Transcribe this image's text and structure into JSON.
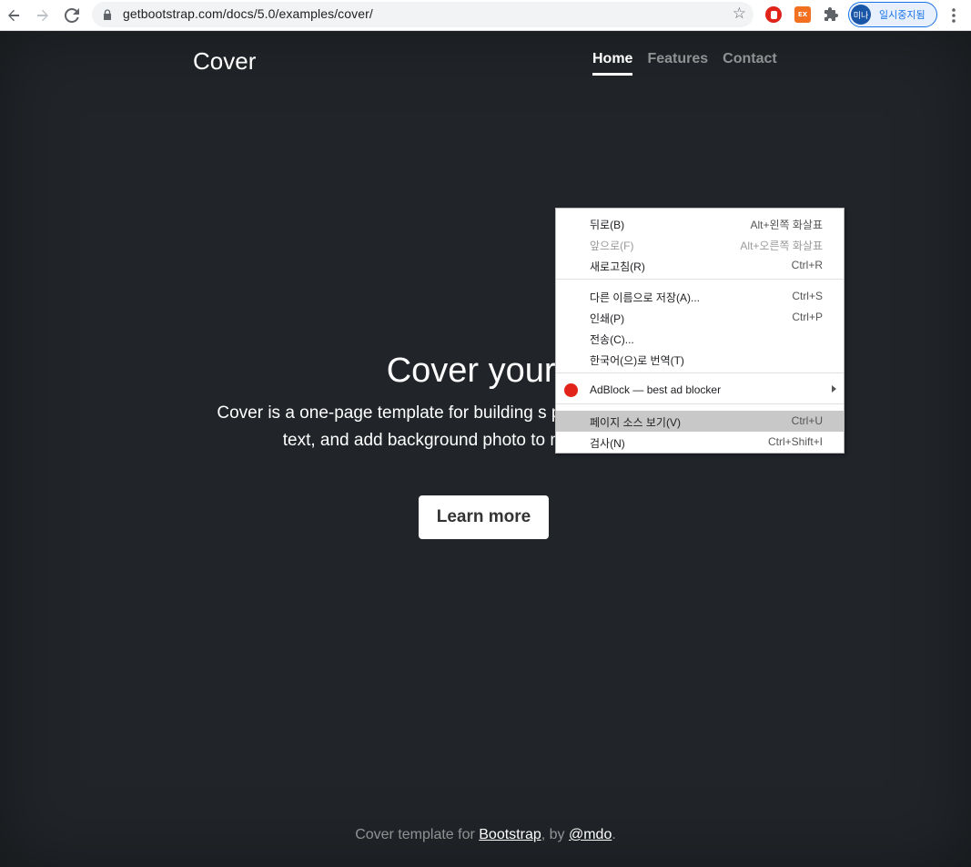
{
  "browser": {
    "url": "getbootstrap.com/docs/5.0/examples/cover/",
    "profile_initials": "미나",
    "profile_label": "일시중지됨",
    "ext_badge": "EX"
  },
  "page": {
    "brand": "Cover",
    "nav": [
      "Home",
      "Features",
      "Contact"
    ],
    "hero_title": "Cover your p",
    "lead": "Cover is a one-page template for building s pages. Download, edit the text, and add background photo to make it your own.",
    "button": "Learn more",
    "footer": {
      "prefix": "Cover template for ",
      "link1": "Bootstrap",
      "middle": ", by ",
      "link2": "@mdo",
      "suffix": "."
    }
  },
  "context_menu": {
    "items": [
      {
        "label": "뒤로(B)",
        "shortcut": "Alt+왼쪽 화살표"
      },
      {
        "label": "앞으로(F)",
        "shortcut": "Alt+오른쪽 화살표"
      },
      {
        "label": "새로고침(R)",
        "shortcut": "Ctrl+R"
      },
      {
        "label": "다른 이름으로 저장(A)...",
        "shortcut": "Ctrl+S"
      },
      {
        "label": "인쇄(P)",
        "shortcut": "Ctrl+P"
      },
      {
        "label": "전송(C)...",
        "shortcut": ""
      },
      {
        "label": "한국어(으)로 번역(T)",
        "shortcut": ""
      },
      {
        "label": "AdBlock — best ad blocker",
        "shortcut": ""
      },
      {
        "label": "페이지 소스 보기(V)",
        "shortcut": "Ctrl+U"
      },
      {
        "label": "검사(N)",
        "shortcut": "Ctrl+Shift+I"
      }
    ]
  }
}
